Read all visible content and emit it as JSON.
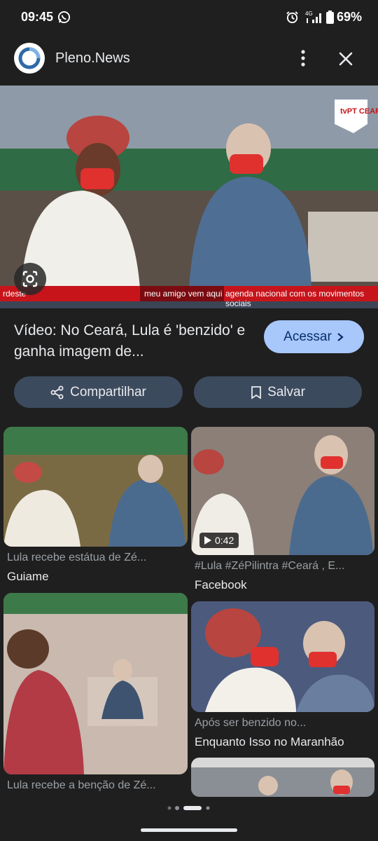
{
  "status_bar": {
    "time": "09:45",
    "network": "4G",
    "battery": "69%"
  },
  "header": {
    "site_name": "Pleno.News"
  },
  "hero": {
    "channel_logo": "tvPT CEARÁ",
    "ticker_left": "rdeste",
    "ticker_mid": "meu amigo vem aqui",
    "ticker_right": "agenda nacional com os movimentos sociais"
  },
  "result": {
    "title": "Vídeo: No Ceará, Lula é 'benzido' e ganha imagem de...",
    "access_label": "Acessar",
    "share_label": "Compartilhar",
    "save_label": "Salvar"
  },
  "grid": [
    {
      "caption": "Lula recebe estátua de Zé...",
      "source": "Guiame"
    },
    {
      "caption": "#Lula #ZéPilintra #Ceará , E...",
      "source": "Facebook",
      "duration": "0:42"
    },
    {
      "caption": "Após ser benzido no...",
      "source": "Enquanto Isso no Maranhão"
    },
    {
      "caption": "Lula recebe a benção de Zé...",
      "source": ""
    }
  ],
  "colors": {
    "background": "#1f1f1f",
    "accent": "#a8c7fa",
    "pill": "#3c4a5e"
  }
}
